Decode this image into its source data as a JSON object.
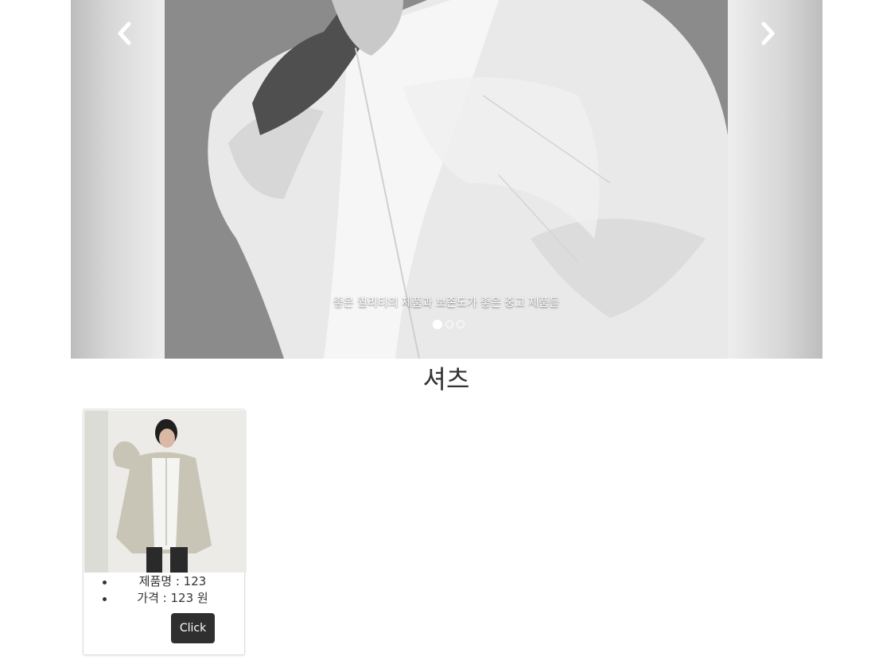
{
  "carousel": {
    "caption": "좋은 퀄리티의 제품과 보존도가 좋은 중고 제품들",
    "prev_icon": "chevron-left-icon",
    "next_icon": "chevron-right-icon",
    "slide_count": 3,
    "active_slide": 1
  },
  "category": {
    "title": "셔츠"
  },
  "products": [
    {
      "name_label": "제품명 : 123",
      "price_label": "가격 : 123 원",
      "button_label": "Click"
    }
  ],
  "colors": {
    "button_bg": "#2f2f2f",
    "text": "#333333"
  }
}
